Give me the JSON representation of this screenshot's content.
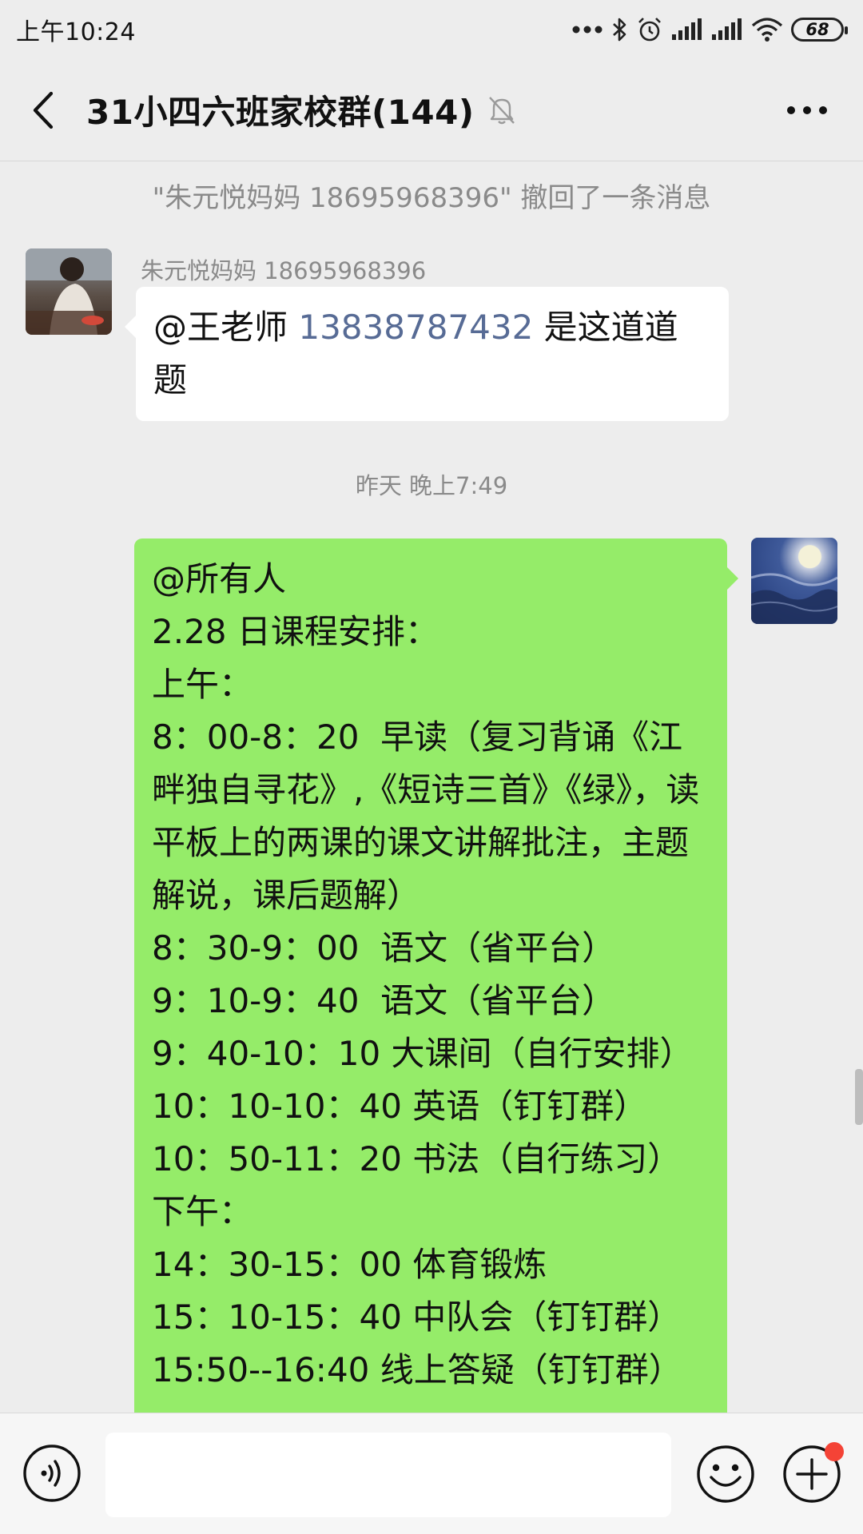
{
  "status_bar": {
    "time": "上午10:24",
    "battery": "68",
    "icons": [
      "more-dots-icon",
      "bluetooth-icon",
      "alarm-icon",
      "signal-icon",
      "signal-icon",
      "wifi-icon",
      "battery-icon"
    ]
  },
  "header": {
    "title": "31小四六班家校群(144)",
    "back_icon": "chevron-left-icon",
    "mute_icon": "bell-off-icon",
    "more_icon": "more-horizontal-icon"
  },
  "messages": {
    "recall_notice": "\"朱元悦妈妈  18695968396\" 撤回了一条消息",
    "msg1": {
      "sender": "朱元悦妈妈  18695968396",
      "mention": "@王老师 ",
      "phone": "13838787432",
      "text": "  是这道道题"
    },
    "timestamp": "昨天 晚上7:49",
    "msg2": {
      "lines": [
        "@所有人",
        "2.28 日课程安排：",
        "上午：",
        "8：00-8：20  早读（复习背诵《江畔独自寻花》,《短诗三首》《绿》，读平板上的两课的课文讲解批注，主题解说，课后题解）",
        "8：30-9：00  语文（省平台）",
        "9：10-9：40  语文（省平台）",
        "9：40-10：10 大课间（自行安排）",
        "10：10-10：40 英语（钉钉群）",
        "10：50-11：20 书法（自行练习）",
        "下午：",
        "14：30-15：00 体育锻炼",
        "15：10-15：40 中队会（钉钉群）",
        "15:50--16:40 线上答疑（钉钉群）"
      ]
    }
  },
  "input_bar": {
    "voice_icon": "voice-icon",
    "input_value": "",
    "emoji_icon": "emoji-icon",
    "plus_icon": "plus-icon"
  },
  "colors": {
    "background": "#ededed",
    "own_bubble": "#95ec69",
    "other_bubble": "#ffffff",
    "link": "#576b95",
    "system_text": "#8a8a8a",
    "badge": "#f44336"
  }
}
